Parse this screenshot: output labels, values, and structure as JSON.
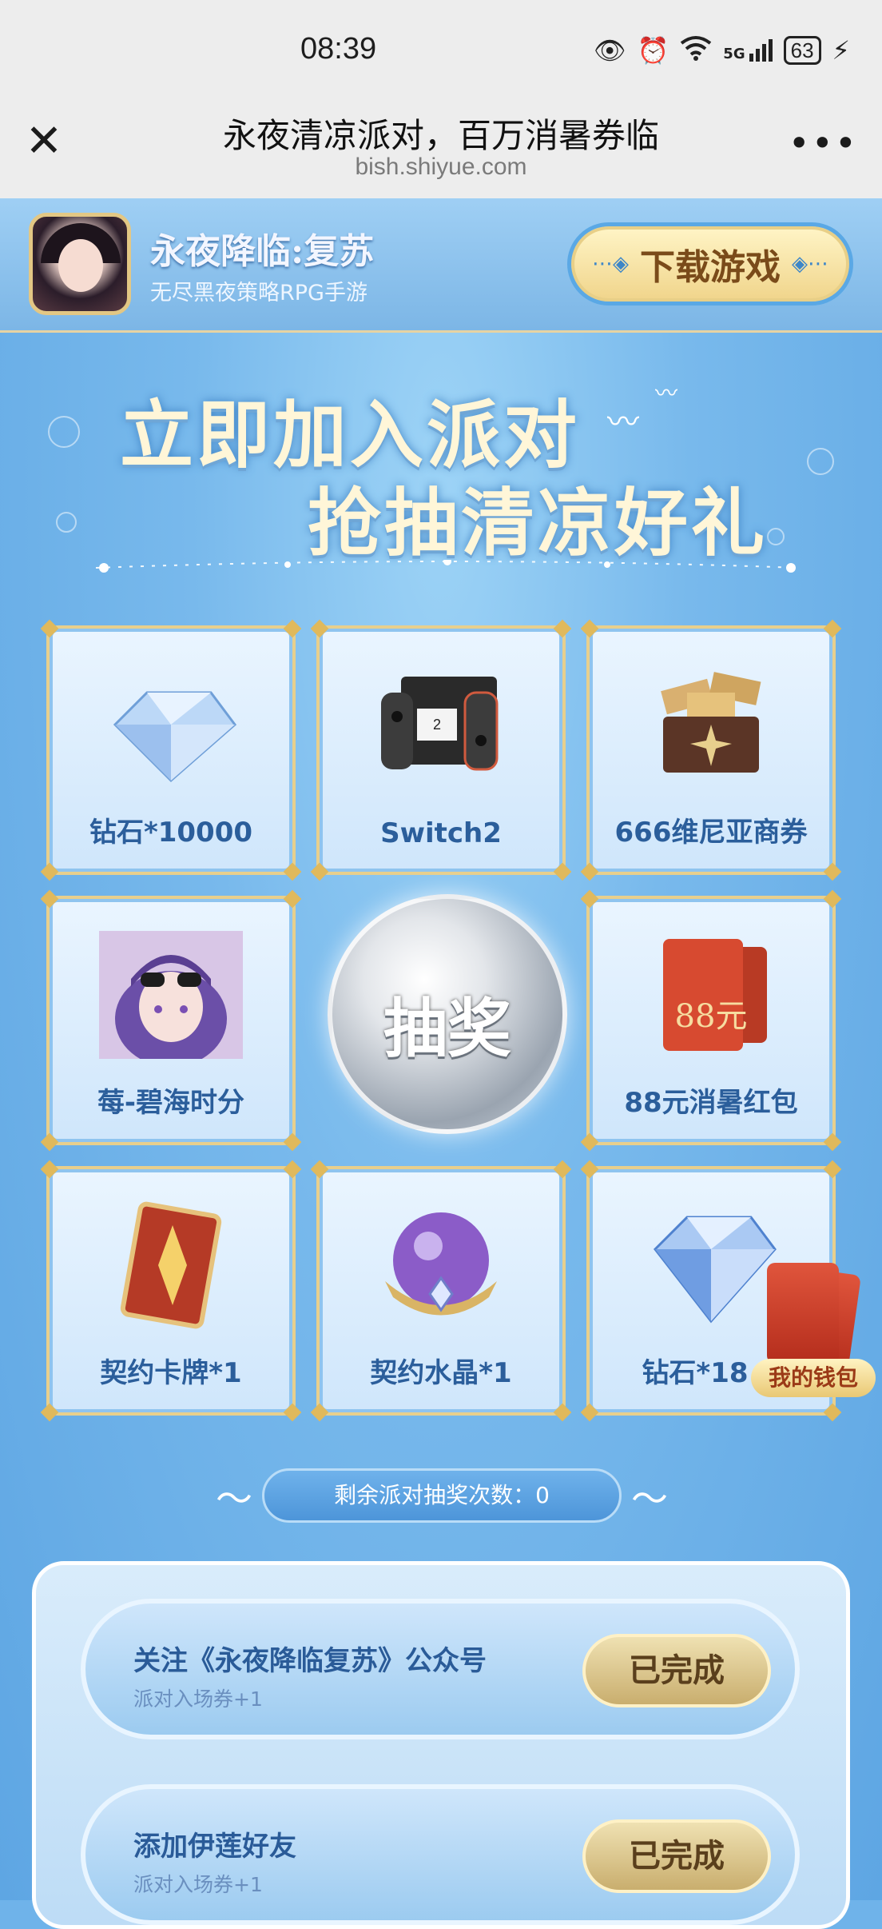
{
  "status_bar": {
    "time": "08:39",
    "battery": "63",
    "network": "5G"
  },
  "nav": {
    "title": "永夜清凉派对，百万消暑券临",
    "url": "bish.shiyue.com",
    "more_label": "•••"
  },
  "banner": {
    "app_name": "永夜降临:复苏",
    "app_subtitle": "无尽黑夜策略RPG手游",
    "download_label": "下载游戏"
  },
  "headline": {
    "line1": "立即加入派对",
    "line2": "抢抽清凉好礼"
  },
  "prizes": [
    {
      "label": "钻石*10000",
      "icon": "diamond-icon"
    },
    {
      "label": "Switch2",
      "icon": "game-console-icon"
    },
    {
      "label": "666维尼亚商券",
      "icon": "treasure-chest-icon"
    },
    {
      "label": "莓-碧海时分",
      "icon": "character-portrait-icon"
    },
    {
      "label": "88元消暑红包",
      "icon": "red-envelope-icon",
      "envelope_text": "88元"
    },
    {
      "label": "契约卡牌*1",
      "icon": "card-icon"
    },
    {
      "label": "契约水晶*1",
      "icon": "crystal-orb-icon"
    },
    {
      "label": "钻石*18",
      "icon": "diamond-icon"
    }
  ],
  "draw_button": {
    "label": "抽奖"
  },
  "wallet": {
    "label": "我的钱包"
  },
  "remaining": {
    "label": "剩余派对抽奖次数：0"
  },
  "tasks": [
    {
      "title": "关注《永夜降临复苏》公众号",
      "subtitle": "派对入场券+1",
      "button": "已完成"
    },
    {
      "title": "添加伊莲好友",
      "subtitle": "派对入场券+1",
      "button": "已完成"
    }
  ],
  "colors": {
    "accent_gold": "#e7cf8d",
    "sky_blue": "#6fb3ea",
    "label_blue": "#2b5e9b"
  }
}
